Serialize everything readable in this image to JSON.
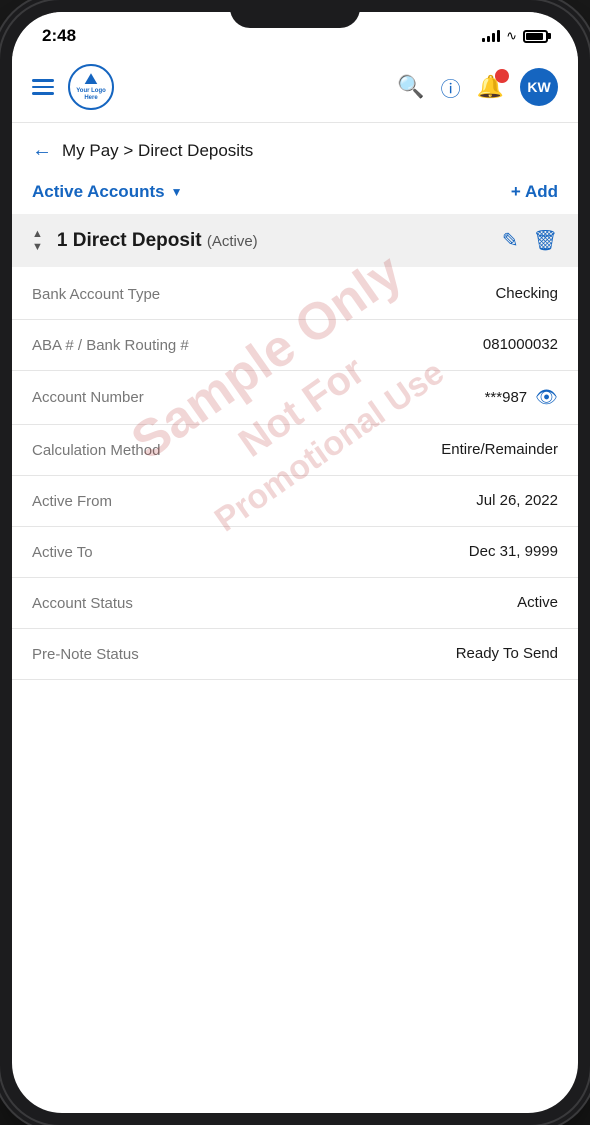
{
  "status_bar": {
    "time": "2:48",
    "avatar_initials": "KW"
  },
  "header": {
    "logo_text": "Your Logo Here",
    "logo_icon": "🏔",
    "hamburger_label": "menu",
    "search_label": "search",
    "help_label": "help",
    "notifications_label": "notifications"
  },
  "breadcrumb": {
    "back_label": "←",
    "path": "My Pay > Direct Deposits"
  },
  "filter": {
    "label": "Active Accounts",
    "add_label": "+ Add"
  },
  "deposit": {
    "number": "1",
    "title": "Direct Deposit",
    "status_badge": "(Active)"
  },
  "details": [
    {
      "label": "Bank Account Type",
      "value": "Checking",
      "has_eye": false
    },
    {
      "label": "ABA # / Bank Routing #",
      "value": "081000032",
      "has_eye": false
    },
    {
      "label": "Account Number",
      "value": "***987",
      "has_eye": true
    },
    {
      "label": "Calculation Method",
      "value": "Entire/Remainder",
      "has_eye": false
    },
    {
      "label": "Active From",
      "value": "Jul 26, 2022",
      "has_eye": false
    },
    {
      "label": "Active To",
      "value": "Dec 31, 9999",
      "has_eye": false
    },
    {
      "label": "Account Status",
      "value": "Active",
      "has_eye": false
    },
    {
      "label": "Pre-Note Status",
      "value": "Ready To Send",
      "has_eye": false
    }
  ],
  "watermark": {
    "lines": [
      "Sample Only",
      "Not For",
      "Promotional Use"
    ]
  }
}
